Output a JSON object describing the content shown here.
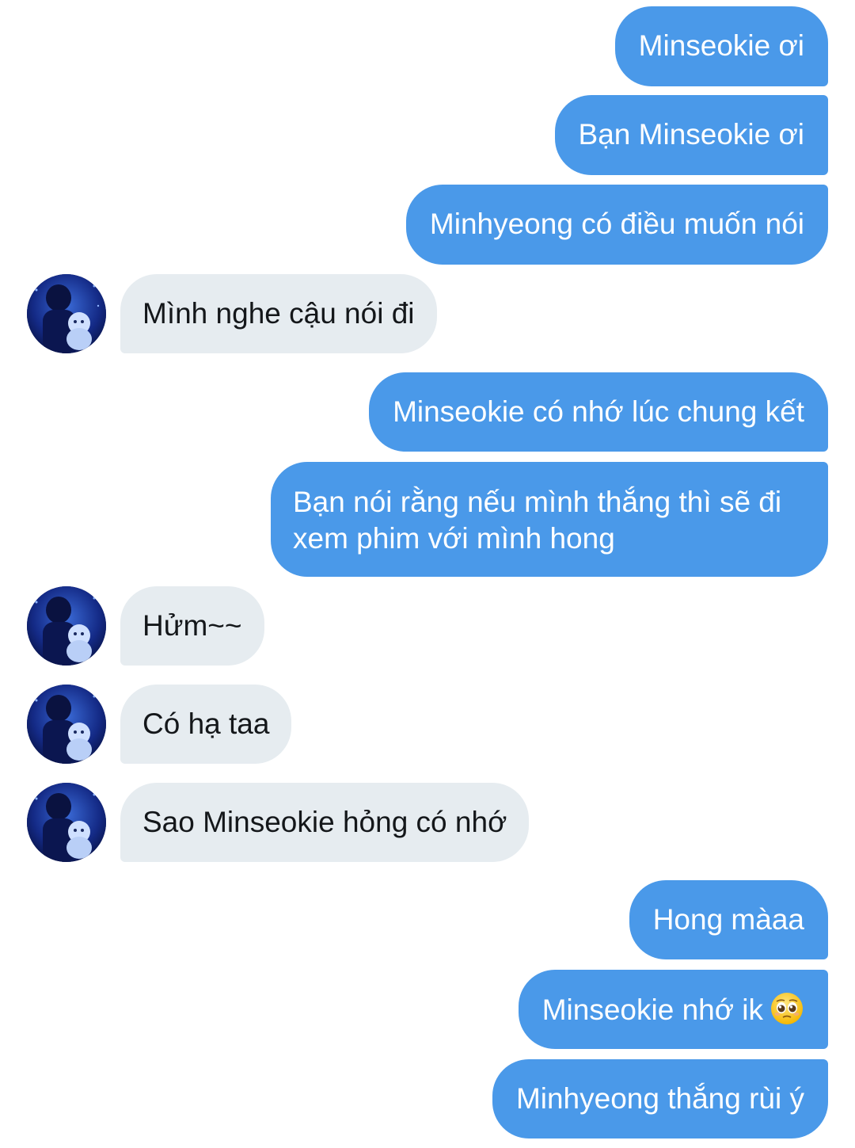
{
  "conversation": {
    "messages": [
      {
        "id": "m1",
        "from": "me",
        "text": "Minseokie ơi"
      },
      {
        "id": "m2",
        "from": "me",
        "text": "Bạn Minseokie ơi"
      },
      {
        "id": "m3",
        "from": "me",
        "text": "Minhyeong có điều muốn nói"
      },
      {
        "id": "m4",
        "from": "other",
        "text": "Mình nghe cậu nói đi"
      },
      {
        "id": "m5",
        "from": "me",
        "text": "Minseokie có nhớ lúc chung kết"
      },
      {
        "id": "m6",
        "from": "me",
        "text": "Bạn nói rằng nếu mình thắng thì sẽ đi xem phim với mình hong"
      },
      {
        "id": "m7",
        "from": "other",
        "text": "Hửm~~"
      },
      {
        "id": "m8",
        "from": "other",
        "text": "Có hạ taa"
      },
      {
        "id": "m9",
        "from": "other",
        "text": "Sao Minseokie hỏng có nhớ"
      },
      {
        "id": "m10",
        "from": "me",
        "text": "Hong màaa"
      },
      {
        "id": "m11",
        "from": "me",
        "text": "Minseokie nhớ ik",
        "emoji": "pleading-face-icon"
      },
      {
        "id": "m12",
        "from": "me",
        "text": "Minhyeong thắng rùi ý"
      }
    ]
  },
  "colors": {
    "outgoing_bubble": "#4a99e9",
    "incoming_bubble": "#e6ecf0",
    "outgoing_text": "#ffffff",
    "incoming_text": "#14171a"
  },
  "icons": {
    "avatar": "profile-photo-avatar",
    "emoji": "pleading-face-icon"
  }
}
